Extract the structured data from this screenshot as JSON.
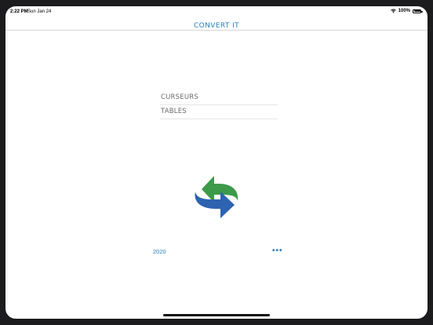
{
  "status_bar": {
    "time": "2:22 PM",
    "date": "Sun Jan 24",
    "battery": "100%"
  },
  "nav": {
    "title": "CONVERT IT"
  },
  "menu": {
    "items": [
      {
        "label": "CURSEURS"
      },
      {
        "label": "TABLES"
      }
    ]
  },
  "footer": {
    "year": "2020",
    "more": "•••"
  },
  "colors": {
    "accent": "#2a7fbd",
    "logo_green": "#3d9a4a",
    "logo_blue": "#2d63b0"
  },
  "icons": [
    "wifi-icon",
    "battery-icon",
    "convert-arrows-logo",
    "more-icon"
  ]
}
